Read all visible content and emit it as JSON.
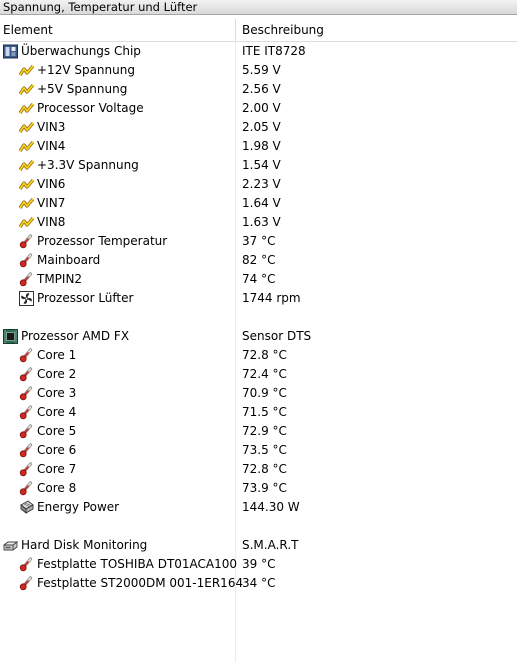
{
  "window": {
    "title": "Spannung, Temperatur und Lüfter"
  },
  "columns": {
    "element": "Element",
    "description": "Beschreibung"
  },
  "groups": [
    {
      "name": "Überwachungs Chip",
      "value": "ITE IT8728",
      "icon": "chip-board-icon",
      "items": [
        {
          "name": "+12V Spannung",
          "value": "5.59 V",
          "icon": "voltage-icon"
        },
        {
          "name": "+5V Spannung",
          "value": "2.56 V",
          "icon": "voltage-icon"
        },
        {
          "name": "Processor Voltage",
          "value": "2.00 V",
          "icon": "voltage-icon"
        },
        {
          "name": "VIN3",
          "value": "2.05 V",
          "icon": "voltage-icon"
        },
        {
          "name": "VIN4",
          "value": "1.98 V",
          "icon": "voltage-icon"
        },
        {
          "name": "+3.3V Spannung",
          "value": "1.54 V",
          "icon": "voltage-icon"
        },
        {
          "name": "VIN6",
          "value": "2.23 V",
          "icon": "voltage-icon"
        },
        {
          "name": "VIN7",
          "value": "1.64 V",
          "icon": "voltage-icon"
        },
        {
          "name": "VIN8",
          "value": "1.63 V",
          "icon": "voltage-icon"
        },
        {
          "name": "Prozessor Temperatur",
          "value": "37 °C",
          "icon": "thermometer-icon"
        },
        {
          "name": "Mainboard",
          "value": "82 °C",
          "icon": "thermometer-icon"
        },
        {
          "name": "TMPIN2",
          "value": "74 °C",
          "icon": "thermometer-icon"
        },
        {
          "name": "Prozessor Lüfter",
          "value": "1744 rpm",
          "icon": "fan-icon"
        }
      ]
    },
    {
      "name": "Prozessor AMD FX",
      "value": "Sensor DTS",
      "icon": "cpu-icon",
      "items": [
        {
          "name": "Core 1",
          "value": "72.8 °C",
          "icon": "thermometer-icon"
        },
        {
          "name": "Core 2",
          "value": "72.4 °C",
          "icon": "thermometer-icon"
        },
        {
          "name": "Core 3",
          "value": "70.9 °C",
          "icon": "thermometer-icon"
        },
        {
          "name": "Core 4",
          "value": "71.5 °C",
          "icon": "thermometer-icon"
        },
        {
          "name": "Core 5",
          "value": "72.9 °C",
          "icon": "thermometer-icon"
        },
        {
          "name": "Core 6",
          "value": "73.5 °C",
          "icon": "thermometer-icon"
        },
        {
          "name": "Core 7",
          "value": "72.8 °C",
          "icon": "thermometer-icon"
        },
        {
          "name": "Core 8",
          "value": "73.9 °C",
          "icon": "thermometer-icon"
        },
        {
          "name": "Energy Power",
          "value": "144.30 W",
          "icon": "power-chip-icon"
        }
      ]
    },
    {
      "name": "Hard Disk Monitoring",
      "value": "S.M.A.R.T",
      "icon": "hard-disk-icon",
      "items": [
        {
          "name": "Festplatte TOSHIBA DT01ACA100",
          "value": "39 °C",
          "icon": "thermometer-icon"
        },
        {
          "name": "Festplatte ST2000DM 001-1ER164",
          "value": "34 °C",
          "icon": "thermometer-icon"
        }
      ]
    }
  ],
  "colors": {
    "voltage": "#e0b000",
    "thermometer": "#c0392b",
    "titlebar": "#dcdcdc"
  }
}
